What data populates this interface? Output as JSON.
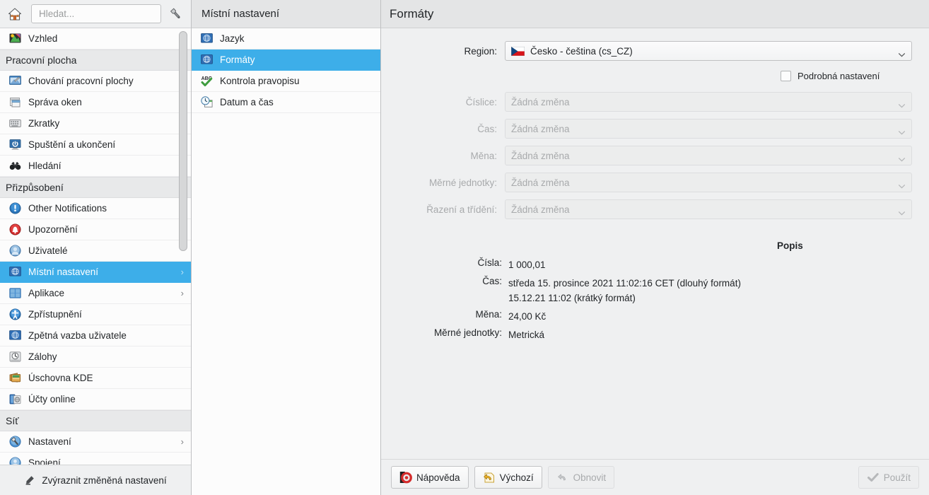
{
  "sidebar": {
    "home_icon": "home-icon",
    "search": {
      "placeholder": "Hledat...",
      "value": ""
    },
    "configure_icon": "wrench-icon",
    "groups": [
      {
        "type": "item",
        "label": "Vzhled",
        "icon": "appearance-icon",
        "arrow": "›",
        "selected": false
      },
      {
        "type": "category",
        "label": "Pracovní plocha"
      },
      {
        "type": "item",
        "label": "Chování pracovní plochy",
        "icon": "desktop-behavior-icon",
        "arrow": "›",
        "selected": false
      },
      {
        "type": "item",
        "label": "Správa oken",
        "icon": "window-management-icon",
        "arrow": "›",
        "selected": false
      },
      {
        "type": "item",
        "label": "Zkratky",
        "icon": "keyboard-shortcuts-icon",
        "arrow": "›",
        "selected": false
      },
      {
        "type": "item",
        "label": "Spuštění a ukončení",
        "icon": "startup-shutdown-icon",
        "arrow": "›",
        "selected": false
      },
      {
        "type": "item",
        "label": "Hledání",
        "icon": "binoculars-icon",
        "arrow": "›",
        "selected": false
      },
      {
        "type": "category",
        "label": "Přizpůsobení"
      },
      {
        "type": "item",
        "label": "Other Notifications",
        "icon": "notification-icon",
        "arrow": "",
        "selected": false
      },
      {
        "type": "item",
        "label": "Upozornění",
        "icon": "bell-icon",
        "arrow": "",
        "selected": false
      },
      {
        "type": "item",
        "label": "Uživatelé",
        "icon": "user-icon",
        "arrow": "",
        "selected": false
      },
      {
        "type": "item",
        "label": "Místní nastavení",
        "icon": "globe-icon",
        "arrow": "›",
        "selected": true
      },
      {
        "type": "item",
        "label": "Aplikace",
        "icon": "applications-icon",
        "arrow": "›",
        "selected": false
      },
      {
        "type": "item",
        "label": "Zpřístupnění",
        "icon": "accessibility-icon",
        "arrow": "",
        "selected": false
      },
      {
        "type": "item",
        "label": "Zpětná vazba uživatele",
        "icon": "globe-icon",
        "arrow": "",
        "selected": false
      },
      {
        "type": "item",
        "label": "Zálohy",
        "icon": "backup-icon",
        "arrow": "",
        "selected": false
      },
      {
        "type": "item",
        "label": "Úschovna KDE",
        "icon": "wallet-icon",
        "arrow": "",
        "selected": false
      },
      {
        "type": "item",
        "label": "Účty online",
        "icon": "online-accounts-icon",
        "arrow": "",
        "selected": false
      },
      {
        "type": "category",
        "label": "Síť"
      },
      {
        "type": "item",
        "label": "Nastavení",
        "icon": "network-settings-icon",
        "arrow": "›",
        "selected": false
      },
      {
        "type": "item",
        "label": "Spojení",
        "icon": "network-connections-icon",
        "arrow": "",
        "selected": false
      }
    ],
    "footer": {
      "label": "Zvýraznit změněná nastavení",
      "icon": "highlighter-icon"
    }
  },
  "midpanel": {
    "title": "Místní nastavení",
    "items": [
      {
        "label": "Jazyk",
        "icon": "globe-icon",
        "selected": false
      },
      {
        "label": "Formáty",
        "icon": "globe-icon",
        "selected": true
      },
      {
        "label": "Kontrola pravopisu",
        "icon": "spellcheck-icon",
        "selected": false
      },
      {
        "label": "Datum a čas",
        "icon": "clock-calendar-icon",
        "selected": false
      }
    ]
  },
  "main": {
    "title": "Formáty",
    "region": {
      "label": "Region:",
      "value": "Česko - čeština (cs_CZ)",
      "flag": "cz-flag",
      "chevron": "chevron-down-icon"
    },
    "detailed_checkbox": {
      "label": "Podrobná nastavení",
      "checked": false
    },
    "detail_rows": [
      {
        "label": "Číslice:",
        "value": "Žádná změna",
        "disabled": true
      },
      {
        "label": "Čas:",
        "value": "Žádná změna",
        "disabled": true
      },
      {
        "label": "Měna:",
        "value": "Žádná změna",
        "disabled": true
      },
      {
        "label": "Měrné jednotky:",
        "value": "Žádná změna",
        "disabled": true
      },
      {
        "label": "Řazení a třídění:",
        "value": "Žádná změna",
        "disabled": true
      }
    ],
    "description": {
      "title": "Popis",
      "rows": [
        {
          "label": "Čísla:",
          "value": "1 000,01"
        },
        {
          "label": "Čas:",
          "value": "středa 15. prosince 2021 11:02:16 CET (dlouhý formát)\n15.12.21 11:02 (krátký formát)"
        },
        {
          "label": "Měna:",
          "value": "24,00 Kč"
        },
        {
          "label": "Měrné jednotky:",
          "value": "Metrická"
        }
      ]
    },
    "buttons": {
      "help": {
        "label": "Nápověda",
        "icon": "help-icon",
        "disabled": false
      },
      "defaults": {
        "label": "Výchozí",
        "icon": "undo-defaults-icon",
        "disabled": false
      },
      "reset": {
        "label": "Obnovit",
        "icon": "reset-icon",
        "disabled": true
      },
      "apply": {
        "label": "Použít",
        "icon": "checkmark-icon",
        "disabled": true
      }
    }
  },
  "colors": {
    "accent": "#3daee9",
    "window_bg": "#eff0f1",
    "view_bg": "#fcfcfc",
    "text": "#232629",
    "disabled_text": "#a8aaac"
  }
}
